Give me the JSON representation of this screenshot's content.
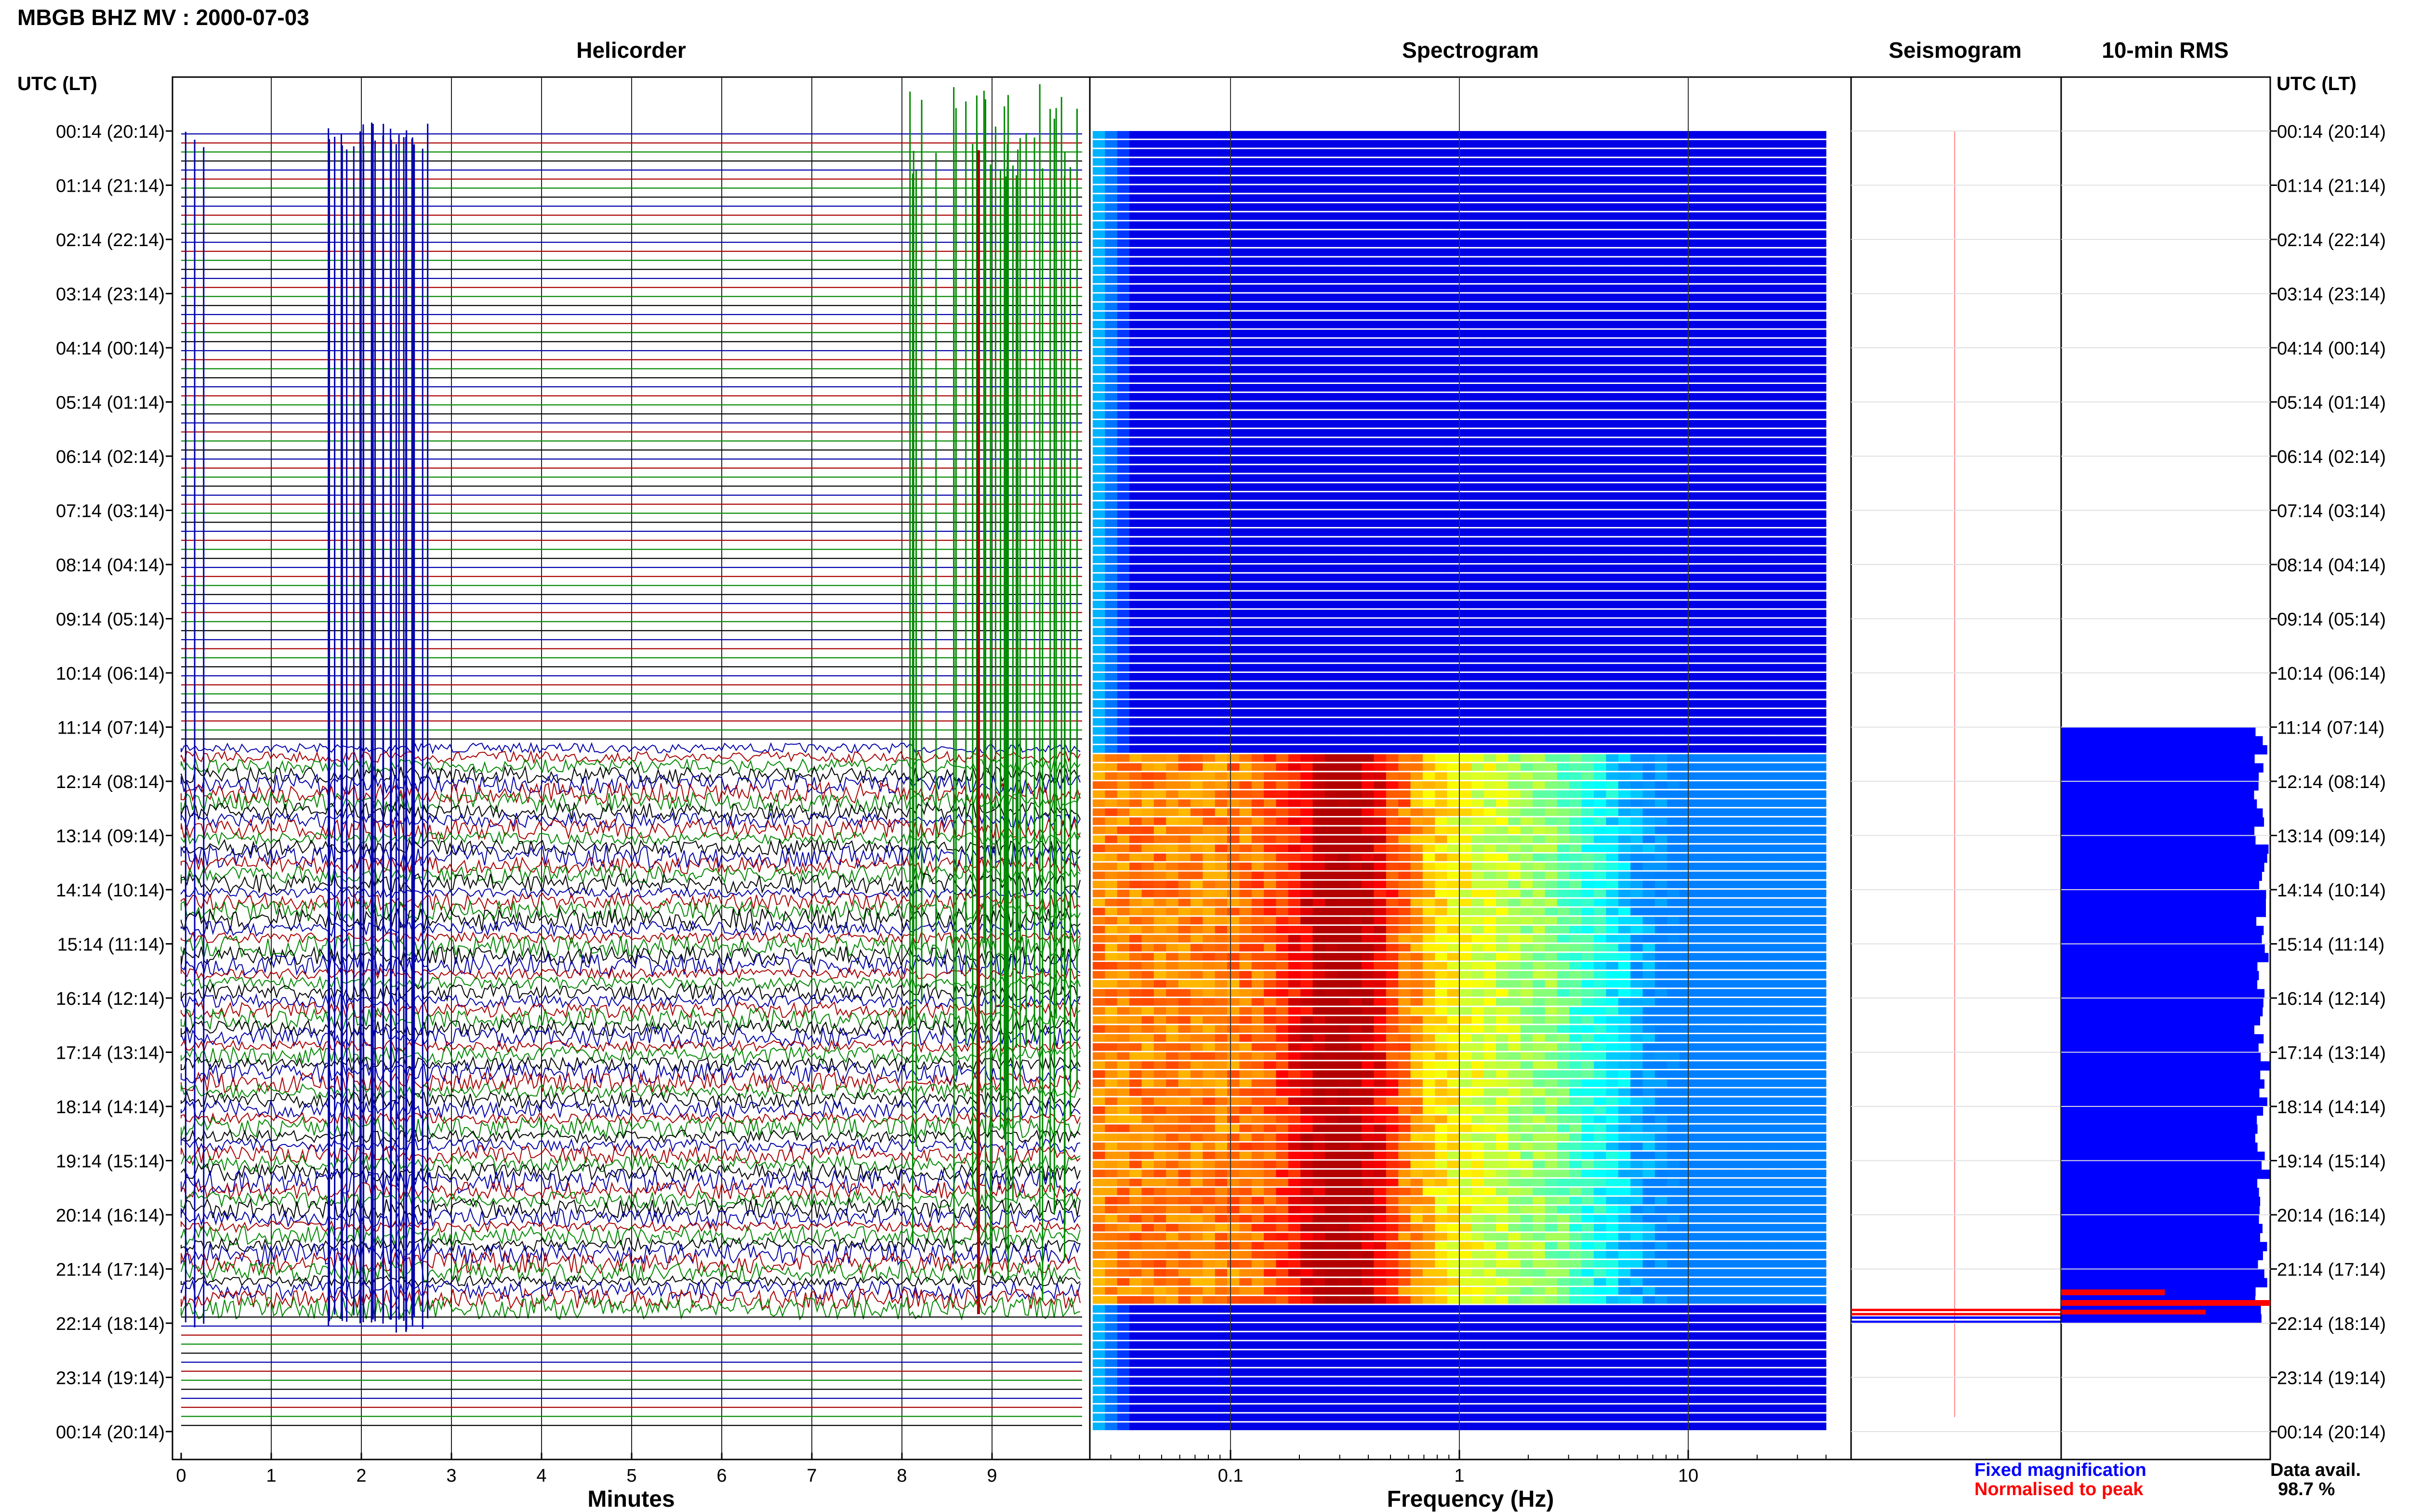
{
  "header": {
    "title": "MBGB BHZ MV : 2000-07-03"
  },
  "chart_data": {
    "type": "composite",
    "panels": [
      {
        "id": "helicorder",
        "title": "Helicorder",
        "type": "line",
        "xlabel": "Minutes",
        "xlim": [
          0,
          10
        ],
        "x_ticks": [
          "0",
          "1",
          "2",
          "3",
          "4",
          "5",
          "6",
          "7",
          "8",
          "9"
        ],
        "rows_per_hour": 6,
        "colors": [
          "#0000aa",
          "#aa0000",
          "#008800",
          "#000000"
        ],
        "active_span_utc": [
          "11:14",
          "22:14"
        ]
      },
      {
        "id": "spectrogram",
        "title": "Spectrogram",
        "type": "heatmap",
        "xlabel": "Frequency (Hz)",
        "x_scale": "log",
        "xlim": [
          0.025,
          40
        ],
        "x_ticks": [
          "0.1",
          "1",
          "10"
        ],
        "x_tick_values": [
          0.1,
          1,
          10
        ],
        "colormap": "jet",
        "dominant_band_hz": [
          0.2,
          0.5
        ],
        "active_span_utc": [
          "11:14",
          "22:14"
        ]
      },
      {
        "id": "seismogram",
        "title": "Seismogram",
        "type": "line",
        "marker_rows_utc": [
          "21:54",
          "22:04"
        ],
        "colors": [
          "#0000ff",
          "#ff0000"
        ]
      },
      {
        "id": "rms",
        "title": "10-min RMS",
        "type": "bar",
        "orientation": "horizontal",
        "active_span_utc": [
          "11:14",
          "22:14"
        ],
        "colors": [
          "#0000ff",
          "#ff0000"
        ]
      }
    ],
    "y_axis": {
      "label": "UTC (LT)",
      "ticks": [
        "00:14 (20:14)",
        "01:14 (21:14)",
        "02:14 (22:14)",
        "03:14 (23:14)",
        "04:14 (00:14)",
        "05:14 (01:14)",
        "06:14 (02:14)",
        "07:14 (03:14)",
        "08:14 (04:14)",
        "09:14 (05:14)",
        "10:14 (06:14)",
        "11:14 (07:14)",
        "12:14 (08:14)",
        "13:14 (09:14)",
        "14:14 (10:14)",
        "15:14 (11:14)",
        "16:14 (12:14)",
        "17:14 (13:14)",
        "18:14 (14:14)",
        "19:14 (15:14)",
        "20:14 (16:14)",
        "21:14 (17:14)",
        "22:14 (18:14)",
        "23:14 (19:14)",
        "00:14 (20:14)"
      ]
    },
    "legend": {
      "fixed": {
        "label": "Fixed magnification",
        "color": "#0000ff"
      },
      "normalised": {
        "label": "Normalised to peak",
        "color": "#ff0000"
      }
    },
    "data_availability": {
      "label": "Data avail.",
      "value": "98.7 %"
    }
  }
}
